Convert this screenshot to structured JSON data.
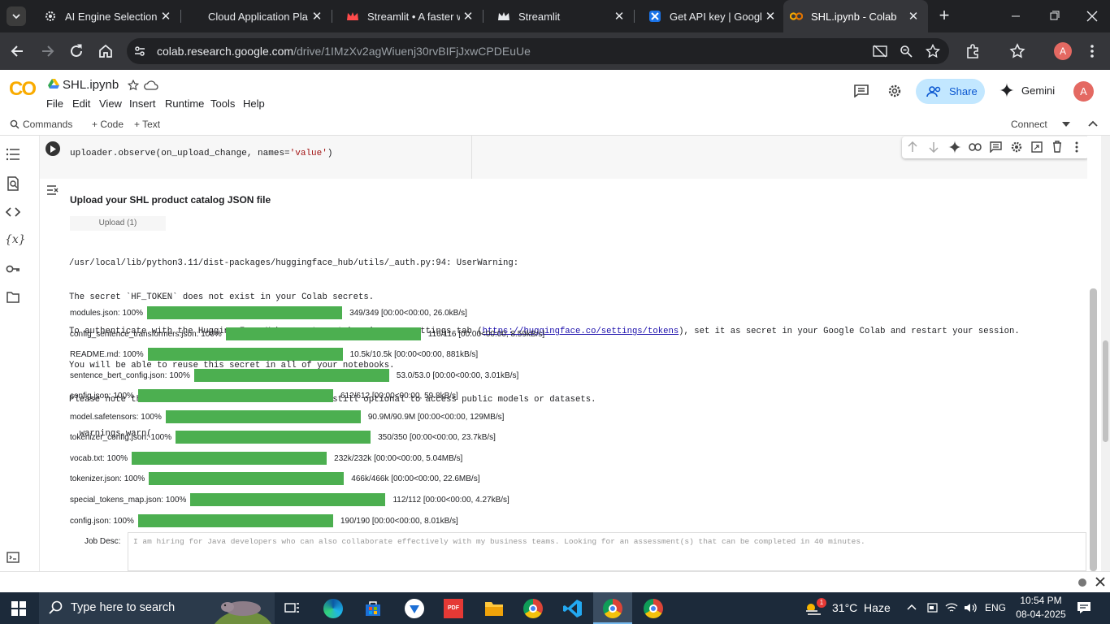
{
  "browser": {
    "tabs": [
      {
        "title": "AI Engine Selection fo",
        "active": false
      },
      {
        "title": "Cloud Application Pla",
        "active": false
      },
      {
        "title": "Streamlit • A faster w",
        "active": false
      },
      {
        "title": "Streamlit",
        "active": false
      },
      {
        "title": "Get API key | Google",
        "active": false
      },
      {
        "title": "SHL.ipynb - Colab",
        "active": true
      }
    ],
    "url_host": "colab.research.google.com",
    "url_path": "/drive/1IMzXv2agWiuenj30rvBIFjJxwCPDEuUe",
    "profile_initial": "A"
  },
  "colab": {
    "logo": "CO",
    "notebook_name": "SHL.ipynb",
    "menu": [
      "File",
      "Edit",
      "View",
      "Insert",
      "Runtime",
      "Tools",
      "Help"
    ],
    "share_label": "Share",
    "gemini_label": "Gemini",
    "avatar_initial": "A",
    "commands_label": "Commands",
    "add_code_label": "+ Code",
    "add_text_label": "+ Text",
    "connect_label": "Connect"
  },
  "cell": {
    "code_line_pre": "uploader.observe(on_upload_change, names=",
    "code_line_str": "'value'",
    "code_line_post": ")"
  },
  "output": {
    "heading": "Upload your SHL product catalog JSON file",
    "upload_button": "Upload (1)",
    "warning_lines": [
      "/usr/local/lib/python3.11/dist-packages/huggingface_hub/utils/_auth.py:94: UserWarning:",
      "The secret `HF_TOKEN` does not exist in your Colab secrets.",
      "To authenticate with the Hugging Face Hub, create a token in your settings tab (",
      "You will be able to reuse this secret in all of your notebooks.",
      "Please note that authentication is recommended but still optional to access public models or datasets.",
      "  warnings.warn("
    ],
    "warning_link": "https://huggingface.co/settings/tokens",
    "warning_link_tail": "), set it as secret in your Google Colab and restart your session.",
    "progress": [
      {
        "name": "modules.json: ",
        "pct": "100%",
        "fraction": 1.0,
        "stats": "349/349 [00:00<00:00, 26.0kB/s]"
      },
      {
        "name": "config_sentence_transformers.json: ",
        "pct": "100%",
        "fraction": 1.0,
        "stats": "116/116 [00:00<00:00, 8.59kB/s]"
      },
      {
        "name": "README.md: ",
        "pct": "100%",
        "fraction": 1.0,
        "stats": "10.5k/10.5k [00:00<00:00, 881kB/s]"
      },
      {
        "name": "sentence_bert_config.json: ",
        "pct": "100%",
        "fraction": 1.0,
        "stats": "53.0/53.0 [00:00<00:00, 3.01kB/s]"
      },
      {
        "name": "config.json: ",
        "pct": "100%",
        "fraction": 1.0,
        "stats": "612/612 [00:00<00:00, 59.8kB/s]"
      },
      {
        "name": "model.safetensors: ",
        "pct": "100%",
        "fraction": 1.0,
        "stats": "90.9M/90.9M [00:00<00:00, 129MB/s]"
      },
      {
        "name": "tokenizer_config.json: ",
        "pct": "100%",
        "fraction": 1.0,
        "stats": "350/350 [00:00<00:00, 23.7kB/s]"
      },
      {
        "name": "vocab.txt: ",
        "pct": "100%",
        "fraction": 1.0,
        "stats": "232k/232k [00:00<00:00, 5.04MB/s]"
      },
      {
        "name": "tokenizer.json: ",
        "pct": "100%",
        "fraction": 1.0,
        "stats": "466k/466k [00:00<00:00, 22.6MB/s]"
      },
      {
        "name": "special_tokens_map.json: ",
        "pct": "100%",
        "fraction": 1.0,
        "stats": "112/112 [00:00<00:00, 4.27kB/s]"
      },
      {
        "name": "config.json: ",
        "pct": "100%",
        "fraction": 1.0,
        "stats": "190/190 [00:00<00:00, 8.01kB/s]"
      }
    ],
    "job_desc_label": "Job Desc:",
    "job_desc_placeholder": "I am hiring for Java developers who can also collaborate effectively with my business teams. Looking for an assessment(s) that can be completed in 40 minutes."
  },
  "taskbar": {
    "search_placeholder": "Type here to search",
    "weather": "31°C  Haze",
    "weather_badge": "1",
    "language": "ENG",
    "time": "10:54 PM",
    "date": "08-04-2025"
  },
  "colors": {
    "progress_green": "#4caf50",
    "colab_orange": "#f9ab00",
    "share_bg": "#c2e7ff",
    "tab_bar": "#202124"
  }
}
